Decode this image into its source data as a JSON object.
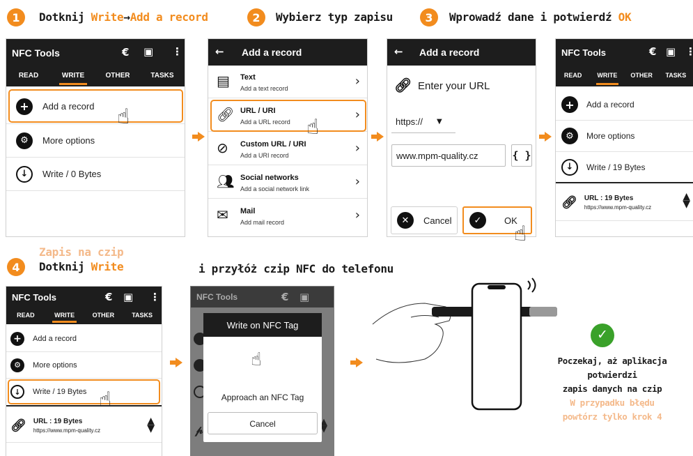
{
  "colors": {
    "accent": "#f28c1e",
    "appbar": "#1d1d1d",
    "success": "#3aa12a",
    "secondary_orange": "#f4b98a"
  },
  "steps": [
    {
      "num": "1",
      "text_a": "Dotknij ",
      "hl1": "Write",
      "text_b": "→",
      "hl2": "Add a record"
    },
    {
      "num": "2",
      "text": "Wybierz typ zapisu"
    },
    {
      "num": "3",
      "text": "Wprowadź dane i potwierdź ",
      "hl": "OK"
    },
    {
      "num": "4",
      "sub": "Zapis na czip",
      "text": "Dotknij ",
      "hl": "Write"
    }
  ],
  "step4_extra": "i przyłóż czip NFC do telefonu",
  "app": {
    "title": "NFC Tools",
    "tabs": [
      "READ",
      "WRITE",
      "OTHER",
      "TASKS"
    ],
    "add_record": "Add a record",
    "more_options": "More options",
    "write_0": "Write / 0 Bytes",
    "write_19": "Write / 19 Bytes",
    "url_record_title": "URL : 19 Bytes",
    "url_record_value": "https://www.mpm-quality.cz"
  },
  "add_record_screen": {
    "title": "Add a record",
    "types": [
      {
        "title": "Text",
        "desc": "Add a text record",
        "icon": "document-icon"
      },
      {
        "title": "URL / URI",
        "desc": "Add a URL record",
        "icon": "link-icon"
      },
      {
        "title": "Custom URL / URI",
        "desc": "Add a URI record",
        "icon": "custom-link-icon"
      },
      {
        "title": "Social networks",
        "desc": "Add a social network link",
        "icon": "people-icon"
      },
      {
        "title": "Mail",
        "desc": "Add mail record",
        "icon": "envelope-icon"
      }
    ]
  },
  "url_screen": {
    "title": "Add a record",
    "prompt": "Enter your URL",
    "scheme": "https://",
    "url_value": "www.mpm-quality.cz",
    "braces": "{ }",
    "cancel": "Cancel",
    "ok": "OK"
  },
  "dialog": {
    "title": "Write on NFC Tag",
    "message": "Approach an NFC Tag",
    "cancel": "Cancel"
  },
  "final": {
    "line1": "Poczekaj, aż aplikacja potwierdzi",
    "line2": "zapis danych na czip",
    "line3": "W przypadku błędu",
    "line4": "powtórz tylko krok 4"
  }
}
